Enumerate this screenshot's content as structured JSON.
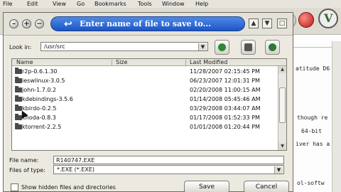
{
  "menubar": {
    "items": [
      "File",
      "Edit",
      "View",
      "Go",
      "Bookmarks",
      "Tools",
      "Window",
      "Help"
    ]
  },
  "background_page": {
    "lines": [
      "atitude D6",
      "though re",
      "64-bit",
      "iver has a",
      "ol-softw"
    ]
  },
  "dialog": {
    "title": "Enter name of file to save to...",
    "look_in_label": "Look in:",
    "look_in_value": "/usr/src",
    "columns": {
      "name": "Name",
      "size": "Size",
      "last_modified": "Last Modified"
    },
    "files": [
      {
        "name": "r2p-0.6.1.30",
        "modified": "11/28/2007 02:15:45 PM"
      },
      {
        "name": "ieswlinux-3.0.5",
        "modified": "06/23/2007 12:01:31 PM"
      },
      {
        "name": "john-1.7.0.2",
        "modified": "02/20/2008 11:00:15 AM"
      },
      {
        "name": "kdebindings-3.5.6",
        "modified": "01/14/2008 05:45:46 AM"
      },
      {
        "name": "kbirdo-0.2.5",
        "modified": "03/29/2008 03:44:07 AM"
      },
      {
        "name": "knoda-0.8.3",
        "modified": "01/17/2008 01:52:33 PM"
      },
      {
        "name": "ktorrent-2.2.5",
        "modified": "01/01/2008 01:20:44 PM"
      }
    ],
    "file_name_label": "File name:",
    "file_name_value": "R140747.EXE",
    "file_type_label": "Files of type:",
    "file_type_value": "*.EXE (*.EXE)",
    "show_hidden_label": "Show hidden files and directories",
    "save_label": "Save",
    "cancel_label": "Cancel"
  }
}
